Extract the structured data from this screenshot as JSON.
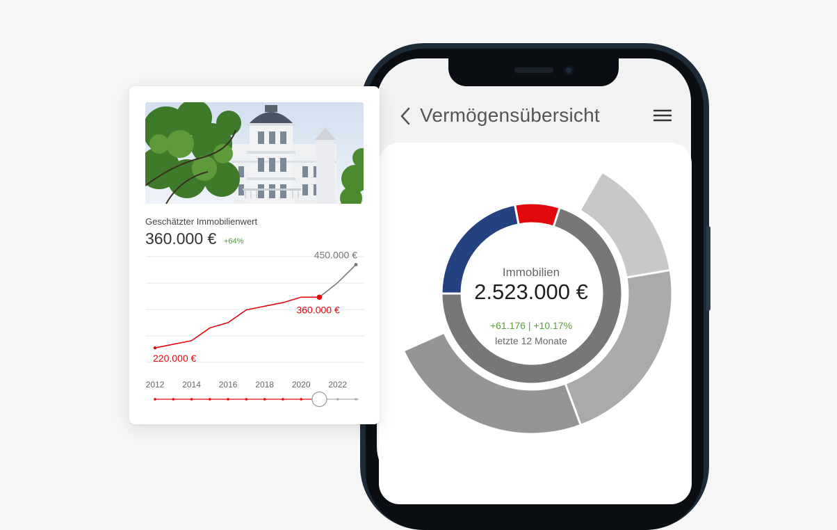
{
  "app": {
    "screen_title": "Vermögensübersicht",
    "back_icon": "chevron-left-icon",
    "menu_icon": "hamburger-menu-icon"
  },
  "summary": {
    "category": "Immobilien",
    "value": "2.523.000 €",
    "change": "+61.176 | +10.17%",
    "period": "letzte 12 Monate"
  },
  "property_card": {
    "label": "Geschätzter Immobilienwert",
    "value": "360.000 €",
    "change": "+64%"
  },
  "colors": {
    "accent_red": "#e3070e",
    "navy": "#23427f",
    "positive_green": "#5a9e3a",
    "inactive_gray": "#777777"
  },
  "chart_data": [
    {
      "type": "line",
      "years": [
        2012,
        2013,
        2014,
        2015,
        2016,
        2017,
        2018,
        2019,
        2020,
        2021,
        2022,
        2023
      ],
      "values": [
        220000,
        230000,
        240000,
        275000,
        290000,
        325000,
        335000,
        345000,
        360000,
        360000,
        400000,
        450000
      ],
      "highlight_index": 9,
      "projection_start_index": 9,
      "annotations": [
        "220.000 €",
        "360.000 €",
        "450.000 €"
      ],
      "xtick_labels": [
        "2012",
        "2014",
        "2016",
        "2018",
        "2020",
        "2022"
      ],
      "ylim": [
        180000,
        470000
      ]
    },
    {
      "type": "pie",
      "inner_ring": [
        {
          "color": "#23427f",
          "fraction": 0.22
        },
        {
          "color": "#e3070e",
          "fraction": 0.08
        },
        {
          "color": "#777777",
          "fraction": 0.7
        }
      ],
      "outer_ring": [
        {
          "color": "#c8c8c8",
          "fraction": 0.14
        },
        {
          "color": "#aaaaaa",
          "fraction": 0.22
        },
        {
          "color": "#959595",
          "fraction": 0.24
        }
      ]
    }
  ]
}
